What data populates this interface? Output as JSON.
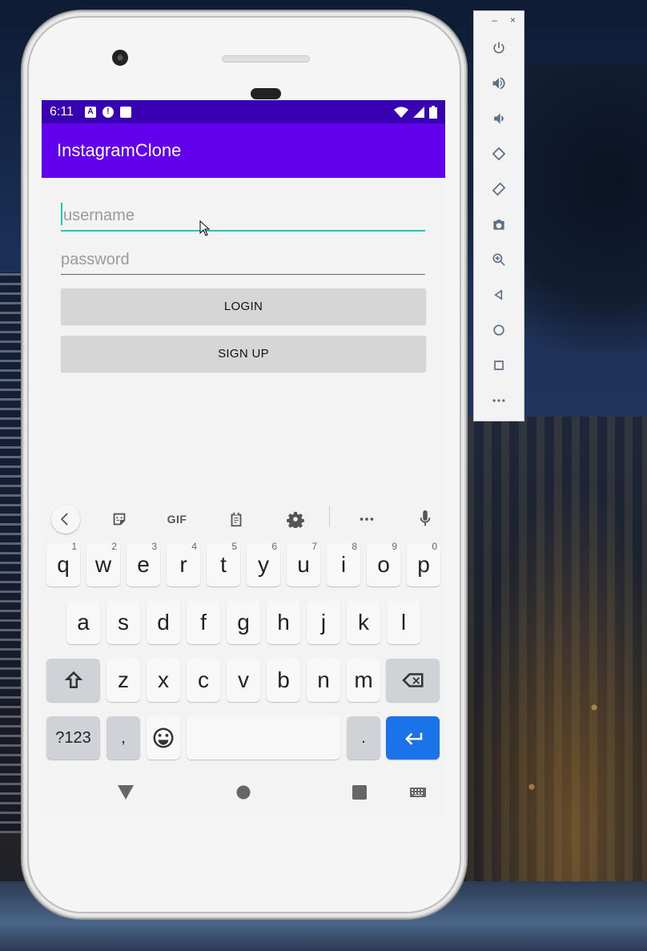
{
  "emulator": {
    "minimize": "–",
    "close": "×",
    "tools": [
      "power-icon",
      "volume-up-icon",
      "volume-down-icon",
      "rotate-left-icon",
      "rotate-right-icon",
      "camera-icon",
      "zoom-icon",
      "back-icon",
      "home-icon",
      "overview-icon",
      "more-icon"
    ]
  },
  "status": {
    "time": "6:11",
    "icon_a": "A",
    "icon_b": "!"
  },
  "app": {
    "title": "InstagramClone"
  },
  "form": {
    "username_placeholder": "username",
    "password_placeholder": "password",
    "login_label": "LOGIN",
    "signup_label": "SIGN UP"
  },
  "keyboard": {
    "gif_label": "GIF",
    "row1": [
      {
        "k": "q",
        "h": "1"
      },
      {
        "k": "w",
        "h": "2"
      },
      {
        "k": "e",
        "h": "3"
      },
      {
        "k": "r",
        "h": "4"
      },
      {
        "k": "t",
        "h": "5"
      },
      {
        "k": "y",
        "h": "6"
      },
      {
        "k": "u",
        "h": "7"
      },
      {
        "k": "i",
        "h": "8"
      },
      {
        "k": "o",
        "h": "9"
      },
      {
        "k": "p",
        "h": "0"
      }
    ],
    "row2": [
      "a",
      "s",
      "d",
      "f",
      "g",
      "h",
      "j",
      "k",
      "l"
    ],
    "row3": [
      "z",
      "x",
      "c",
      "v",
      "b",
      "n",
      "m"
    ],
    "symbols_label": "?123",
    "comma": ",",
    "period": ".",
    "accent": "#1a73e8"
  },
  "colors": {
    "statusbar": "#3700b3",
    "appbar": "#6200ee",
    "focus": "#26c6b7"
  }
}
